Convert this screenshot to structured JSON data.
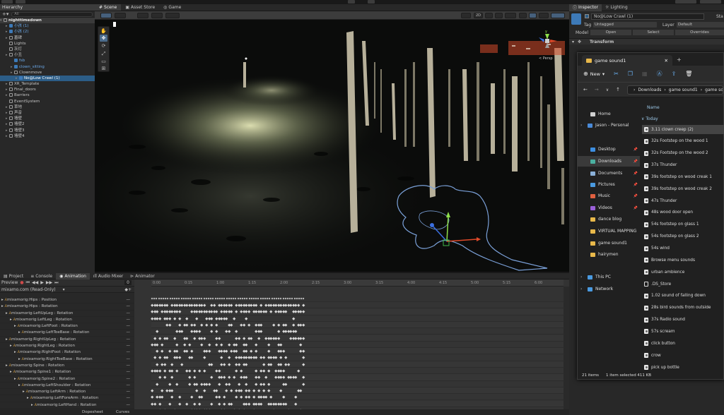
{
  "hierarchy": {
    "tab": "Hierarchy",
    "search_placeholder": "All",
    "scene_name": "nighttimedown",
    "items": [
      {
        "label": "小孩 (1)"
      },
      {
        "label": "小孩 (2)"
      },
      {
        "label": "墓碑"
      },
      {
        "label": "Lights"
      },
      {
        "label": "灰灯"
      },
      {
        "label": "小丑"
      },
      {
        "label": "fsb"
      },
      {
        "label": "clown_sitting"
      },
      {
        "label": "Clownmove"
      },
      {
        "label": "No@Low Crawl (1)"
      },
      {
        "label": "XR_Template"
      },
      {
        "label": "Final_doors"
      },
      {
        "label": "Barriers"
      },
      {
        "label": "EventSystem"
      },
      {
        "label": "草地"
      },
      {
        "label": "声音"
      },
      {
        "label": "墙壁"
      },
      {
        "label": "墙壁2"
      },
      {
        "label": "墙壁3"
      },
      {
        "label": "墙壁4"
      }
    ]
  },
  "scene_tabs": {
    "scene": "Scene",
    "asset_store": "Asset Store",
    "game": "Game"
  },
  "scene_toolbar": {
    "mode_2d": "2D",
    "persp": "< Persp"
  },
  "bottom_tabs": {
    "project": "Project",
    "console": "Console",
    "animation": "Animation",
    "audio_mixer": "Audio Mixer",
    "animator": "Animator"
  },
  "animation": {
    "preview": "Preview",
    "frame": "0",
    "clip": "mixamo.com (Read-Only)",
    "ruler_labels": [
      "0:00",
      "0:15",
      "1:00",
      "1:15",
      "2:00",
      "2:15",
      "3:00",
      "3:15",
      "4:00",
      "4:15",
      "5:00",
      "5:15",
      "6:00"
    ],
    "properties": [
      {
        "label": "mixamorig:Hips : Position"
      },
      {
        "label": "mixamorig:Hips : Rotation"
      },
      {
        "label": "mixamorig:LeftUpLeg : Rotation"
      },
      {
        "label": "mixamorig:LeftLeg : Rotation"
      },
      {
        "label": "mixamorig:LeftFoot : Rotation"
      },
      {
        "label": "mixamorig:LeftToeBase : Rotation"
      },
      {
        "label": "mixamorig:RightUpLeg : Rotation"
      },
      {
        "label": "mixamorig:RightLeg : Rotation"
      },
      {
        "label": "mixamorig:RightFoot : Rotation"
      },
      {
        "label": "mixamorig:RightToeBase : Rotation"
      },
      {
        "label": "mixamorig:Spine : Rotation"
      },
      {
        "label": "mixamorig:Spine1 : Rotation"
      },
      {
        "label": "mixamorig:Spine2 : Rotation"
      },
      {
        "label": "mixamorig:LeftShoulder : Rotation"
      },
      {
        "label": "mixamorig:LeftArm : Rotation"
      },
      {
        "label": "mixamorig:LeftForeArm : Rotation"
      },
      {
        "label": "mixamorig:LeftHand : Rotation"
      }
    ],
    "dopesheet": "Dopesheet",
    "curves": "Curves"
  },
  "inspector": {
    "tabs": {
      "inspector": "Inspector",
      "lighting": "Lighting"
    },
    "object_name": "No@Low Crawl (1)",
    "static": "Sta",
    "tag_label": "Tag",
    "tag_value": "Untagged",
    "layer_label": "Layer",
    "layer_value": "Default",
    "model_label": "Model",
    "open": "Open",
    "select": "Select",
    "overrides": "Overrides",
    "transform": "Transform"
  },
  "explorer": {
    "tab_title": "game sound1",
    "new_label": "New",
    "breadcrumb": [
      "Downloads",
      "game sound1",
      "game so"
    ],
    "column_name": "Name",
    "group_today": "Today",
    "nav_items": [
      {
        "label": "Home",
        "kind": "home"
      },
      {
        "label": "Jason - Personal",
        "kind": "cloud"
      },
      {
        "label": "Desktop",
        "kind": "folder-blue"
      },
      {
        "label": "Downloads",
        "kind": "download"
      },
      {
        "label": "Documents",
        "kind": "doc"
      },
      {
        "label": "Pictures",
        "kind": "pic"
      },
      {
        "label": "Music",
        "kind": "music"
      },
      {
        "label": "Videos",
        "kind": "video"
      },
      {
        "label": "dance blog",
        "kind": "folder"
      },
      {
        "label": "VIRTUAL MAPPING",
        "kind": "folder"
      },
      {
        "label": "game sound1",
        "kind": "folder"
      },
      {
        "label": "hairymen",
        "kind": "folder"
      },
      {
        "label": "This PC",
        "kind": "pc"
      },
      {
        "label": "Network",
        "kind": "net"
      }
    ],
    "files": [
      {
        "label": "3.11 clown creep (2)"
      },
      {
        "label": "32s Footstep on the wood 1"
      },
      {
        "label": "32s Footstep on the wood 2"
      },
      {
        "label": "37s Thunder"
      },
      {
        "label": "39s footstep on wood creak 1"
      },
      {
        "label": "39s footstep on wood creak 2"
      },
      {
        "label": "47s Thunder"
      },
      {
        "label": "48s wood door open"
      },
      {
        "label": "54s footstep on glass 1"
      },
      {
        "label": "54s footstep on glass 2"
      },
      {
        "label": "54s wind"
      },
      {
        "label": "Browse menu sounds"
      },
      {
        "label": "urban ambience"
      },
      {
        "label": ".DS_Store"
      },
      {
        "label": "1.02 sound of falling down"
      },
      {
        "label": "28s bird sounds from outside"
      },
      {
        "label": "37s Radio sound"
      },
      {
        "label": "57s scream"
      },
      {
        "label": "click button"
      },
      {
        "label": "crow"
      },
      {
        "label": "pick up bottle"
      }
    ],
    "status_items": "21 items",
    "status_selected": "1 item selected  411 KB"
  },
  "colors": {
    "accent": "#2c5d87",
    "prefab_blue": "#6aa8e8",
    "keyframe": "#d8d8d8",
    "folder": "#e8b84a"
  }
}
